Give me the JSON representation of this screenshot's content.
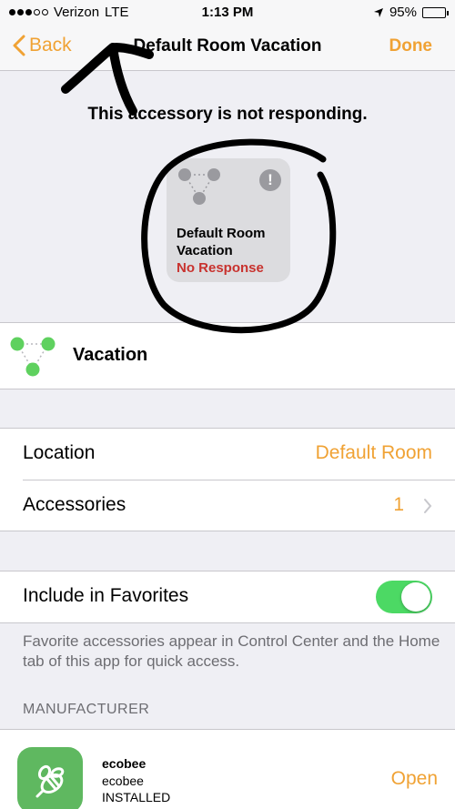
{
  "status_bar": {
    "carrier": "Verizon",
    "network": "LTE",
    "time": "1:13 PM",
    "battery": "95%",
    "battery_level": 0.95
  },
  "nav": {
    "back_label": "Back",
    "title": "Default Room Vacation",
    "done_label": "Done"
  },
  "notice": "This accessory is not responding.",
  "tile": {
    "name": "Default Room Vacation",
    "status": "No Response",
    "alert_glyph": "!"
  },
  "device": {
    "name": "Vacation"
  },
  "settings": {
    "location_label": "Location",
    "location_value": "Default Room",
    "accessories_label": "Accessories",
    "accessories_count": "1"
  },
  "favorites": {
    "label": "Include in Favorites",
    "enabled": true,
    "footnote": "Favorite accessories appear in Control Center and the Home tab of this app for quick access."
  },
  "manufacturer": {
    "header": "MANUFACTURER",
    "app_name": "ecobee",
    "developer": "ecobee",
    "install_state": "INSTALLED",
    "action_label": "Open"
  },
  "colors": {
    "accent": "#f0a234",
    "error": "#c8322e",
    "toggle_on": "#4cd964",
    "app_icon": "#5fb860"
  }
}
